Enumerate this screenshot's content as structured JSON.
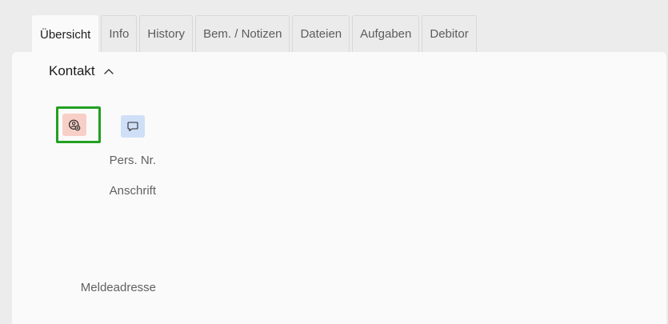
{
  "tabs": [
    {
      "label": "Übersicht",
      "active": true
    },
    {
      "label": "Info",
      "active": false
    },
    {
      "label": "History",
      "active": false
    },
    {
      "label": "Bem. / Notizen",
      "active": false
    },
    {
      "label": "Dateien",
      "active": false
    },
    {
      "label": "Aufgaben",
      "active": false
    },
    {
      "label": "Debitor",
      "active": false
    }
  ],
  "section": {
    "title": "Kontakt",
    "expanded": true
  },
  "actions": {
    "person_icon": "person-badge-icon",
    "chat_icon": "chat-bubble-icon"
  },
  "fields": {
    "pers_nr": "Pers. Nr.",
    "anschrift": "Anschrift",
    "meldeadresse": "Meldeadresse"
  },
  "colors": {
    "person_button": "#f8cfc6",
    "chat_button": "#cfdff7",
    "focus_outline": "#22a022"
  }
}
